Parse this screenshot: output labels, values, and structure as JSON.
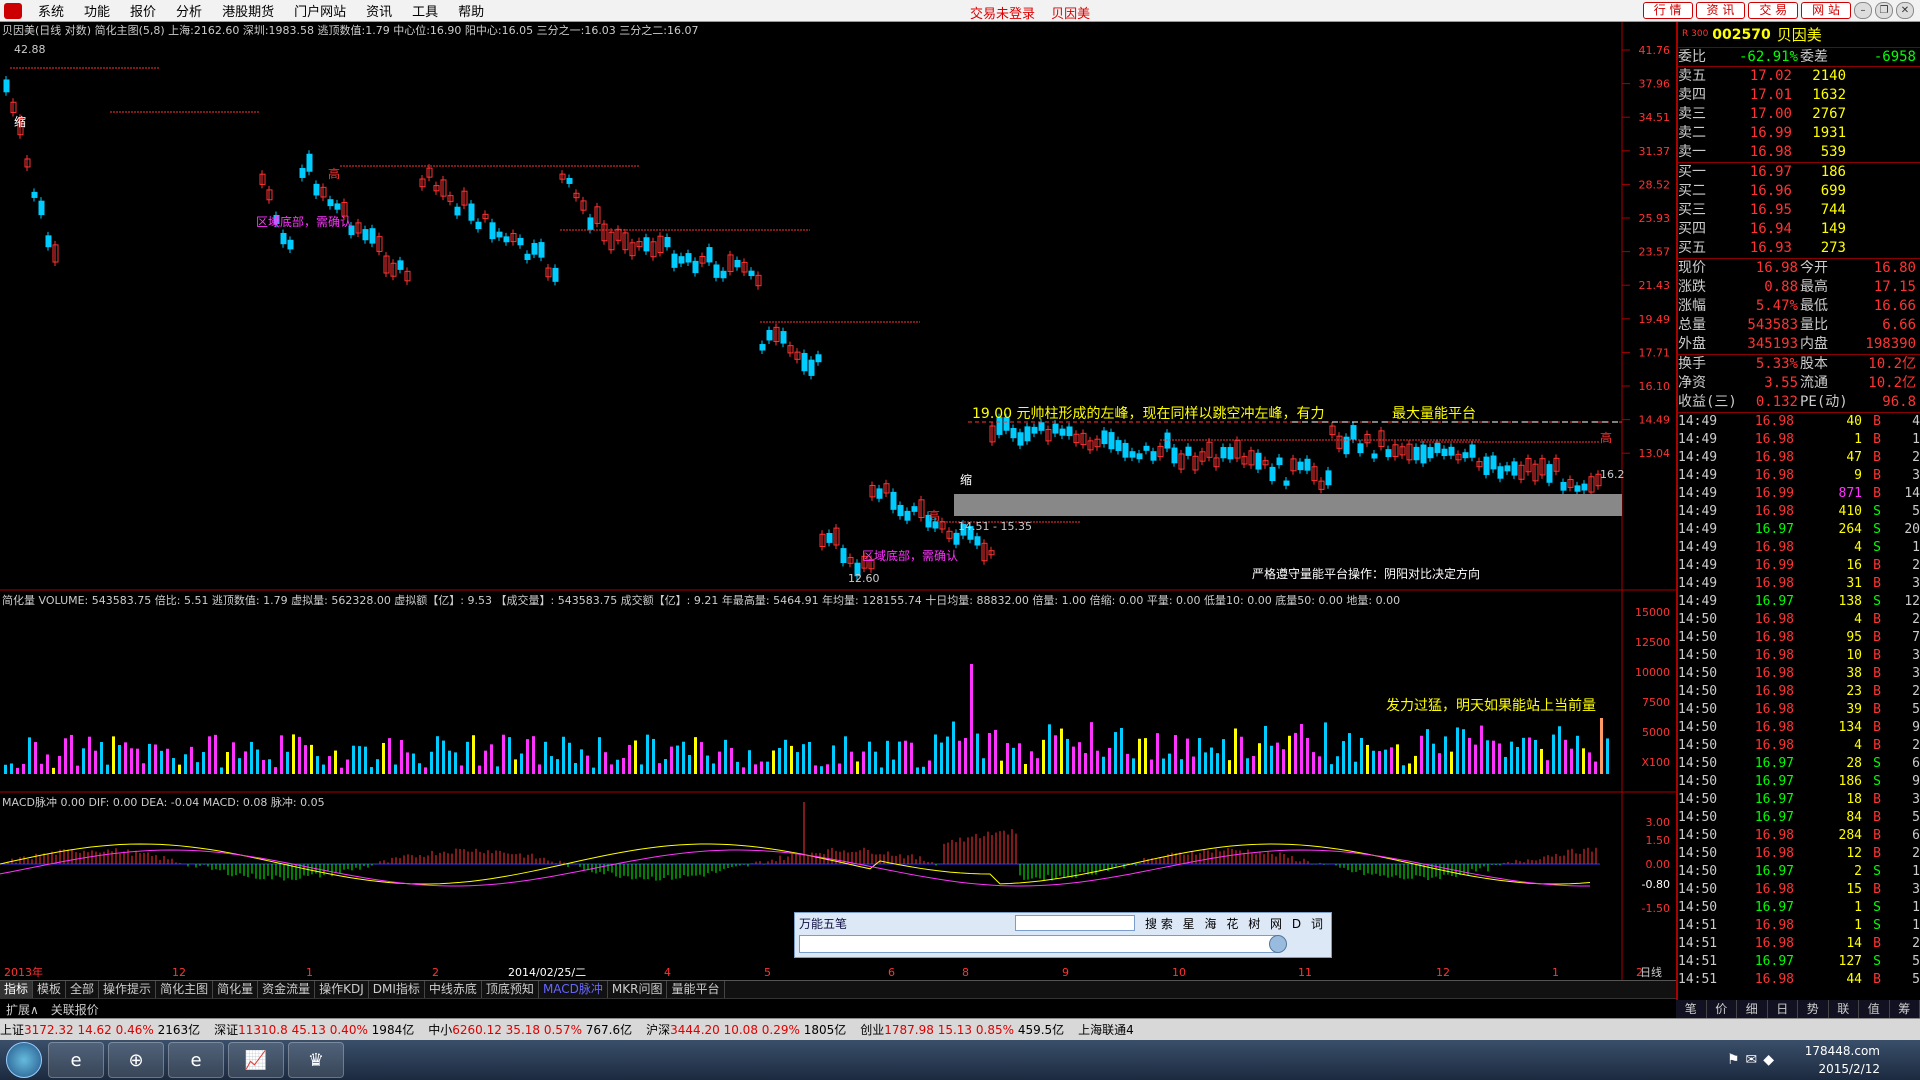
{
  "menubar": {
    "items": [
      "系统",
      "功能",
      "报价",
      "分析",
      "港股期货",
      "门户网站",
      "资讯",
      "工具",
      "帮助"
    ],
    "login_status": "交易未登录",
    "stock_name": "贝因美",
    "right_buttons": [
      "行 情",
      "资 讯",
      "交 易",
      "网 站"
    ]
  },
  "chart_header": "贝因美(日线 对数) 简化主图(5,8)  上海:2162.60  深圳:1983.58  逃顶数值:1.79  中心位:16.90  阳中心:16.05  三分之一:16.03  三分之二:16.07",
  "price_axis": [
    "41.76",
    "37.96",
    "34.51",
    "31.37",
    "28.52",
    "25.93",
    "23.57",
    "21.43",
    "19.49",
    "17.71",
    "16.10",
    "14.49",
    "13.04"
  ],
  "annotations": {
    "high_label": "42.88",
    "low_label": "12.60",
    "range_label": "14.51 - 15.35",
    "right_price": "16.2",
    "top_note": "19.00 元帅柱形成的左峰，现在同样以跳空冲左峰，有力",
    "platform_note": "最大量能平台",
    "strict_note": "严格遵守量能平台操作：阴阳对比决定方向",
    "vol_note": "发力过猛，明天如果能站上当前量",
    "zone1": "区域底部，需确认",
    "zone2": "区域底部，需确认",
    "shrink": "缩",
    "high": "高"
  },
  "volume_header": "简化量 VOLUME: 543583.75 倍比: 5.51 逃顶数值: 1.79 虚拟量: 562328.00 虚拟额【亿】: 9.53 【成交量】: 543583.75 成交额【亿】: 9.21 年最高量: 5464.91 年均量: 128155.74 十日均量: 88832.00 倍量: 1.00 倍缩: 0.00 平量: 0.00 低量10: 0.00 底量50: 0.00 地量: 0.00",
  "volume_axis": [
    "15000",
    "12500",
    "10000",
    "7500",
    "5000",
    "X100"
  ],
  "macd_header": "MACD脉冲  0.00  DIF: 0.00  DEA: -0.04  MACD: 0.08  脉冲: 0.05",
  "macd_axis": [
    "3.00",
    "1.50",
    "0.00",
    "-0.80",
    "-1.50"
  ],
  "time_axis": [
    "2013年",
    "12",
    "1",
    "2",
    "2014/02/25/二",
    "4",
    "5",
    "6",
    "8",
    "9",
    "10",
    "11",
    "12",
    "1",
    "2",
    "日线"
  ],
  "bottom_tabs": [
    "指标",
    "模板",
    "全部",
    "操作提示",
    "简化主图",
    "简化量",
    "资金流量",
    "操作KDJ",
    "DMI指标",
    "中线赤底",
    "顶底预知",
    "MACD脉冲",
    "MKR问图",
    "量能平台"
  ],
  "ext_tabs": [
    "扩展∧",
    "关联报价"
  ],
  "side": {
    "code": "002570",
    "name": "贝因美",
    "r_label": "R 300",
    "weibi": {
      "label": "委比",
      "value": "-62.91%",
      "label2": "委差",
      "value2": "-6958"
    },
    "sells": [
      {
        "label": "卖五",
        "price": "17.02",
        "vol": "2140"
      },
      {
        "label": "卖四",
        "price": "17.01",
        "vol": "1632"
      },
      {
        "label": "卖三",
        "price": "17.00",
        "vol": "2767"
      },
      {
        "label": "卖二",
        "price": "16.99",
        "vol": "1931"
      },
      {
        "label": "卖一",
        "price": "16.98",
        "vol": "539"
      }
    ],
    "buys": [
      {
        "label": "买一",
        "price": "16.97",
        "vol": "186"
      },
      {
        "label": "买二",
        "price": "16.96",
        "vol": "699"
      },
      {
        "label": "买三",
        "price": "16.95",
        "vol": "744"
      },
      {
        "label": "买四",
        "price": "16.94",
        "vol": "149"
      },
      {
        "label": "买五",
        "price": "16.93",
        "vol": "273"
      }
    ],
    "stats": [
      {
        "l1": "现价",
        "v1": "16.98",
        "l2": "今开",
        "v2": "16.80"
      },
      {
        "l1": "涨跌",
        "v1": "0.88",
        "l2": "最高",
        "v2": "17.15"
      },
      {
        "l1": "涨幅",
        "v1": "5.47%",
        "l2": "最低",
        "v2": "16.66"
      },
      {
        "l1": "总量",
        "v1": "543583",
        "l2": "量比",
        "v2": "6.66"
      },
      {
        "l1": "外盘",
        "v1": "345193",
        "l2": "内盘",
        "v2": "198390"
      }
    ],
    "stats2": [
      {
        "l1": "换手",
        "v1": "5.33%",
        "l2": "股本",
        "v2": "10.2亿"
      },
      {
        "l1": "净资",
        "v1": "3.55",
        "l2": "流通",
        "v2": "10.2亿"
      },
      {
        "l1": "收益(三)",
        "v1": "0.132",
        "l2": "PE(动)",
        "v2": "96.8"
      }
    ],
    "ticks": [
      {
        "t": "14:49",
        "p": "16.98",
        "v": "40",
        "bs": "B",
        "n": "4"
      },
      {
        "t": "14:49",
        "p": "16.98",
        "v": "1",
        "bs": "B",
        "n": "1"
      },
      {
        "t": "14:49",
        "p": "16.98",
        "v": "47",
        "bs": "B",
        "n": "2"
      },
      {
        "t": "14:49",
        "p": "16.98",
        "v": "9",
        "bs": "B",
        "n": "3"
      },
      {
        "t": "14:49",
        "p": "16.99",
        "v": "871",
        "bs": "B",
        "n": "14"
      },
      {
        "t": "14:49",
        "p": "16.98",
        "v": "410",
        "bs": "S",
        "n": "5"
      },
      {
        "t": "14:49",
        "p": "16.97",
        "v": "264",
        "bs": "S",
        "n": "20"
      },
      {
        "t": "14:49",
        "p": "16.98",
        "v": "4",
        "bs": "S",
        "n": "1"
      },
      {
        "t": "14:49",
        "p": "16.99",
        "v": "16",
        "bs": "B",
        "n": "2"
      },
      {
        "t": "14:49",
        "p": "16.98",
        "v": "31",
        "bs": "B",
        "n": "3"
      },
      {
        "t": "14:49",
        "p": "16.97",
        "v": "138",
        "bs": "S",
        "n": "12"
      },
      {
        "t": "14:50",
        "p": "16.98",
        "v": "4",
        "bs": "B",
        "n": "2"
      },
      {
        "t": "14:50",
        "p": "16.98",
        "v": "95",
        "bs": "B",
        "n": "7"
      },
      {
        "t": "14:50",
        "p": "16.98",
        "v": "10",
        "bs": "B",
        "n": "3"
      },
      {
        "t": "14:50",
        "p": "16.98",
        "v": "38",
        "bs": "B",
        "n": "3"
      },
      {
        "t": "14:50",
        "p": "16.98",
        "v": "23",
        "bs": "B",
        "n": "2"
      },
      {
        "t": "14:50",
        "p": "16.98",
        "v": "39",
        "bs": "B",
        "n": "5"
      },
      {
        "t": "14:50",
        "p": "16.98",
        "v": "134",
        "bs": "B",
        "n": "9"
      },
      {
        "t": "14:50",
        "p": "16.98",
        "v": "4",
        "bs": "B",
        "n": "2"
      },
      {
        "t": "14:50",
        "p": "16.97",
        "v": "28",
        "bs": "S",
        "n": "6"
      },
      {
        "t": "14:50",
        "p": "16.97",
        "v": "186",
        "bs": "S",
        "n": "9"
      },
      {
        "t": "14:50",
        "p": "16.97",
        "v": "18",
        "bs": "B",
        "n": "3"
      },
      {
        "t": "14:50",
        "p": "16.97",
        "v": "84",
        "bs": "B",
        "n": "5"
      },
      {
        "t": "14:50",
        "p": "16.98",
        "v": "284",
        "bs": "B",
        "n": "6"
      },
      {
        "t": "14:50",
        "p": "16.98",
        "v": "12",
        "bs": "B",
        "n": "2"
      },
      {
        "t": "14:50",
        "p": "16.97",
        "v": "2",
        "bs": "S",
        "n": "1"
      },
      {
        "t": "14:50",
        "p": "16.98",
        "v": "15",
        "bs": "B",
        "n": "3"
      },
      {
        "t": "14:50",
        "p": "16.97",
        "v": "1",
        "bs": "S",
        "n": "1"
      },
      {
        "t": "14:51",
        "p": "16.98",
        "v": "1",
        "bs": "S",
        "n": "1"
      },
      {
        "t": "14:51",
        "p": "16.98",
        "v": "14",
        "bs": "B",
        "n": "2"
      },
      {
        "t": "14:51",
        "p": "16.97",
        "v": "127",
        "bs": "S",
        "n": "5"
      },
      {
        "t": "14:51",
        "p": "16.98",
        "v": "44",
        "bs": "B",
        "n": "5"
      }
    ],
    "tabs": [
      "笔",
      "价",
      "细",
      "日",
      "势",
      "联",
      "值",
      "筹"
    ]
  },
  "statusbar": [
    {
      "name": "上证",
      "price": "3172.32",
      "chg": "14.62",
      "pct": "0.46%",
      "amt": "2163亿"
    },
    {
      "name": "深证",
      "price": "11310.8",
      "chg": "45.13",
      "pct": "0.40%",
      "amt": "1984亿"
    },
    {
      "name": "中小",
      "price": "6260.12",
      "chg": "35.18",
      "pct": "0.57%",
      "amt": "767.6亿"
    },
    {
      "name": "沪深",
      "price": "3444.20",
      "chg": "10.08",
      "pct": "0.29%",
      "amt": "1805亿"
    },
    {
      "name": "创业",
      "price": "1787.98",
      "chg": "15.13",
      "pct": "0.85%",
      "amt": "459.5亿"
    }
  ],
  "status_extra": "上海联通4",
  "wanneng": {
    "title": "万能五笔",
    "search": "搜 索",
    "links": [
      "星",
      "海",
      "花",
      "树",
      "网",
      "D",
      "词"
    ]
  },
  "clock": {
    "time": "",
    "date": "2015/2/12"
  },
  "watermark": "178448.com"
}
